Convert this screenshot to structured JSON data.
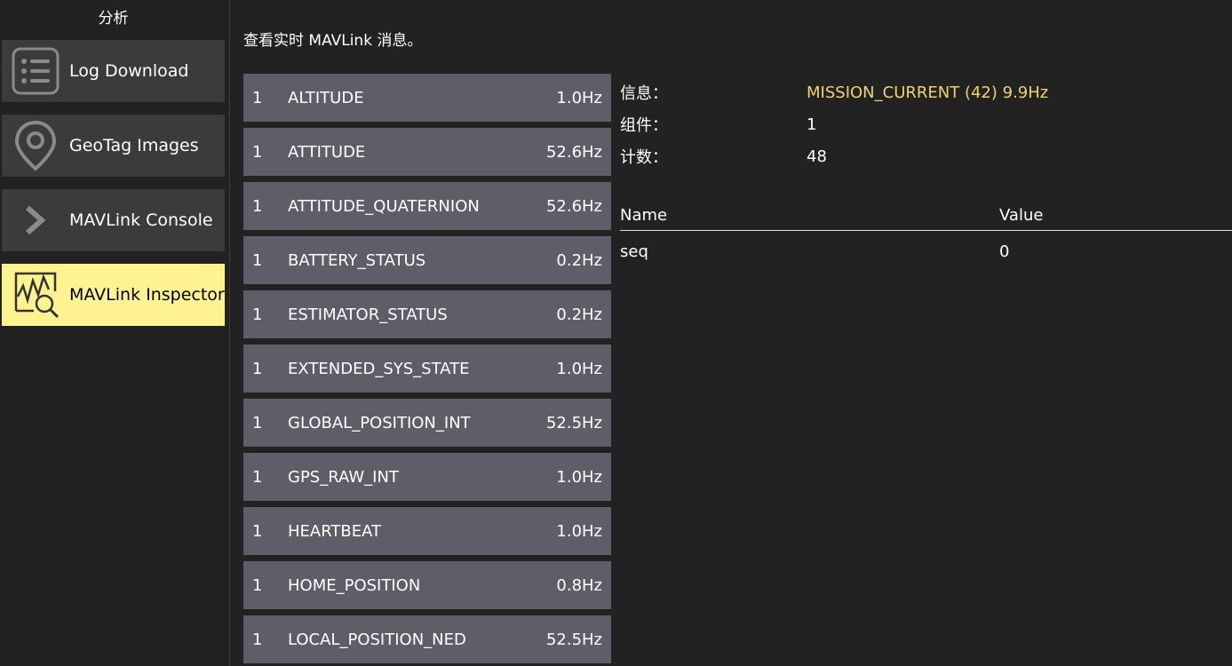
{
  "sidebar": {
    "title": "分析",
    "items": [
      {
        "label": "Log Download",
        "icon": "list-icon",
        "active": false
      },
      {
        "label": "GeoTag Images",
        "icon": "map-pin-icon",
        "active": false
      },
      {
        "label": "MAVLink Console",
        "icon": "chevron-right-icon",
        "active": false
      },
      {
        "label": "MAVLink Inspector",
        "icon": "chart-magnify-icon",
        "active": true
      }
    ]
  },
  "main": {
    "description": "查看实时 MAVLink 消息。",
    "messages": [
      {
        "component": "1",
        "name": "ALTITUDE",
        "rate": "1.0Hz"
      },
      {
        "component": "1",
        "name": "ATTITUDE",
        "rate": "52.6Hz"
      },
      {
        "component": "1",
        "name": "ATTITUDE_QUATERNION",
        "rate": "52.6Hz"
      },
      {
        "component": "1",
        "name": "BATTERY_STATUS",
        "rate": "0.2Hz"
      },
      {
        "component": "1",
        "name": "ESTIMATOR_STATUS",
        "rate": "0.2Hz"
      },
      {
        "component": "1",
        "name": "EXTENDED_SYS_STATE",
        "rate": "1.0Hz"
      },
      {
        "component": "1",
        "name": "GLOBAL_POSITION_INT",
        "rate": "52.5Hz"
      },
      {
        "component": "1",
        "name": "GPS_RAW_INT",
        "rate": "1.0Hz"
      },
      {
        "component": "1",
        "name": "HEARTBEAT",
        "rate": "1.0Hz"
      },
      {
        "component": "1",
        "name": "HOME_POSITION",
        "rate": "0.8Hz"
      },
      {
        "component": "1",
        "name": "LOCAL_POSITION_NED",
        "rate": "52.5Hz"
      }
    ],
    "info": {
      "message_label": "信息：",
      "message_value": "MISSION_CURRENT (42) 9.9Hz",
      "component_label": "组件：",
      "component_value": "1",
      "count_label": "计数：",
      "count_value": "48"
    },
    "fields": {
      "name_header": "Name",
      "value_header": "Value",
      "rows": [
        {
          "name": "seq",
          "value": "0"
        }
      ]
    }
  },
  "colors": {
    "background": "#222222",
    "nav_item": "#3b3b3b",
    "nav_active": "#fff291",
    "message_row": "#5e5e68",
    "highlight_text": "#f0d36a"
  }
}
